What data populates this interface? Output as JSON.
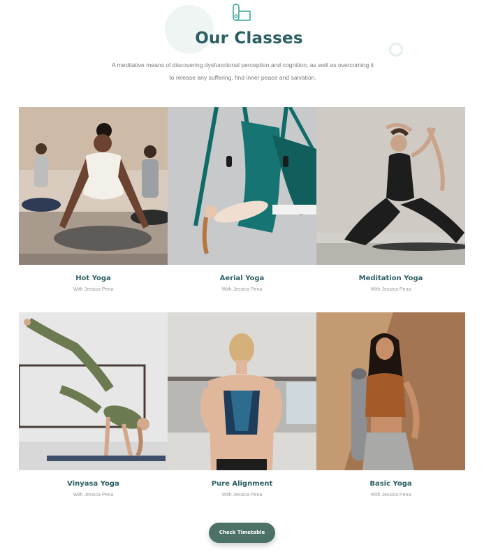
{
  "section": {
    "icon": "yoga-mat-icon",
    "title": "Our Classes",
    "description": "A meditative means of discovering dysfunctional perception and cognition, as well as overcoming it to release any suffering, find inner peace and salvation."
  },
  "classes": [
    {
      "name": "Hot Yoga",
      "instructor": "With Jessica Pena"
    },
    {
      "name": "Aerial Yoga",
      "instructor": "With Jessica Pena"
    },
    {
      "name": "Meditation Yoga",
      "instructor": "With Jessica Pena"
    },
    {
      "name": "Vinyasa Yoga",
      "instructor": "With Jessica Pena"
    },
    {
      "name": "Pure Alignment",
      "instructor": "With Jessica Pena"
    },
    {
      "name": "Basic Yoga",
      "instructor": "With Jessica Pena"
    }
  ],
  "cta": {
    "label": "Check Timetable"
  },
  "colors": {
    "accent": "#2b5f64",
    "button": "#4c7167",
    "icon": "#3aa897"
  }
}
